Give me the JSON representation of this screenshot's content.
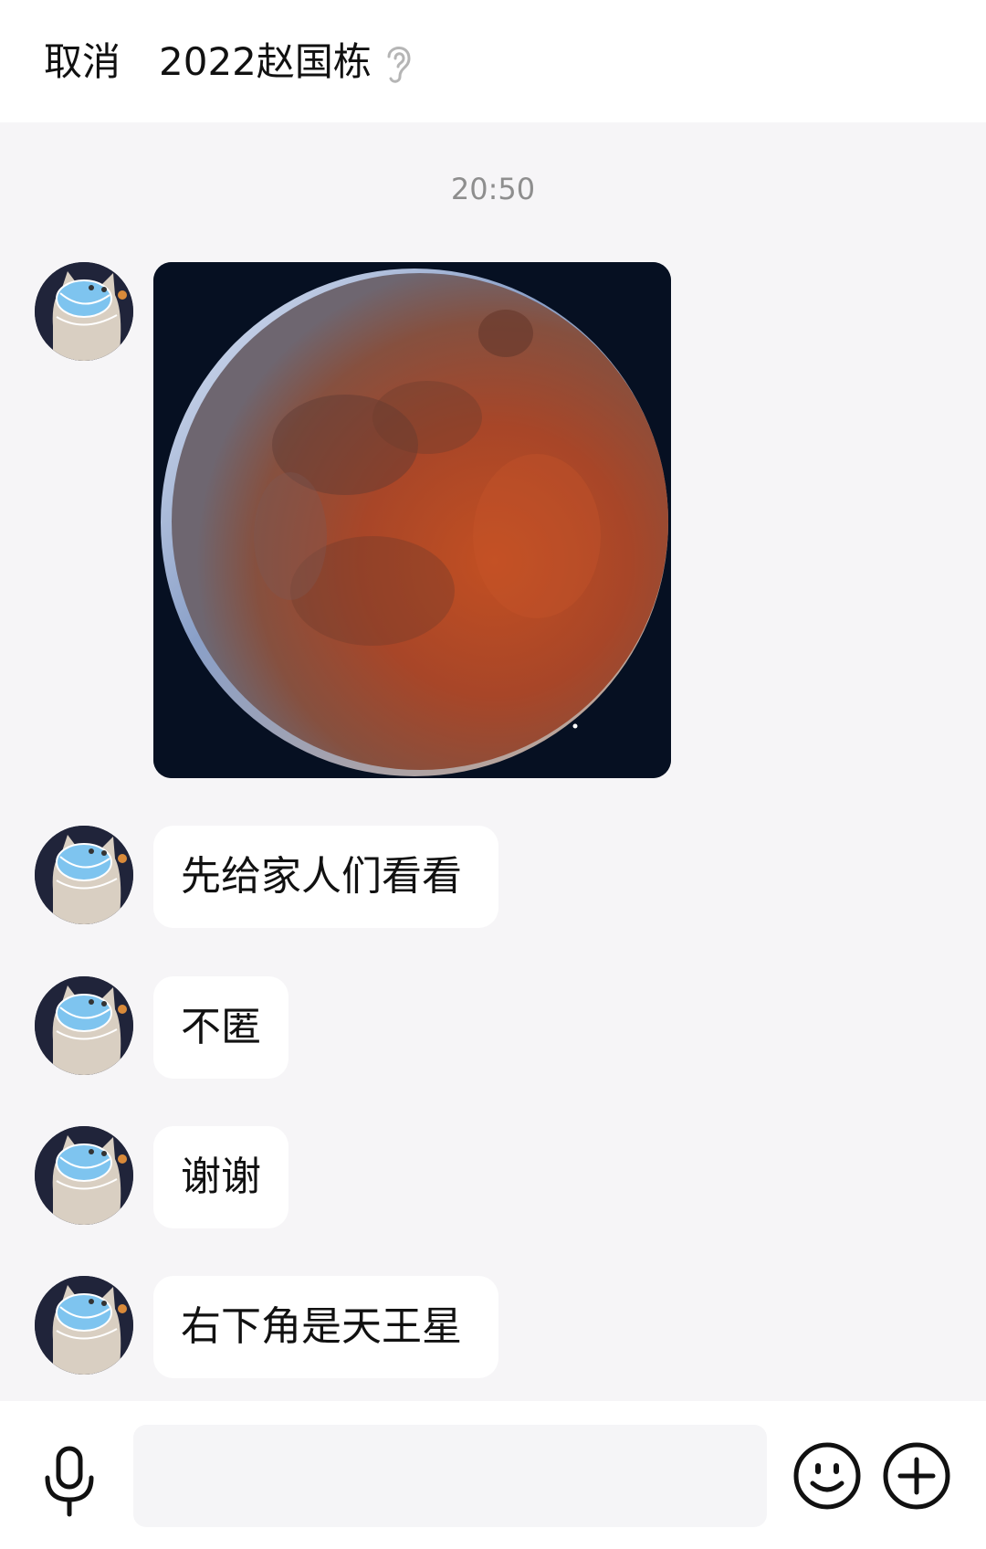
{
  "header": {
    "cancel_label": "取消",
    "title": "2022赵国栋",
    "voice_icon": "ear-icon"
  },
  "chat": {
    "timestamp": "20:50",
    "messages": [
      {
        "type": "image",
        "description_icon": "moon-photo"
      },
      {
        "type": "text",
        "text": "先给家人们看看"
      },
      {
        "type": "text",
        "text": "不匿"
      },
      {
        "type": "text",
        "text": "谢谢"
      },
      {
        "type": "text",
        "text": "右下角是天王星"
      }
    ]
  },
  "input_bar": {
    "left_icon": "microphone-icon",
    "input_value": "",
    "emoji_icon": "smiley-icon",
    "more_icon": "plus-circle-icon"
  },
  "colors": {
    "background": "#f6f5f7",
    "bubble": "#ffffff",
    "timestamp": "#8e8e8e"
  }
}
